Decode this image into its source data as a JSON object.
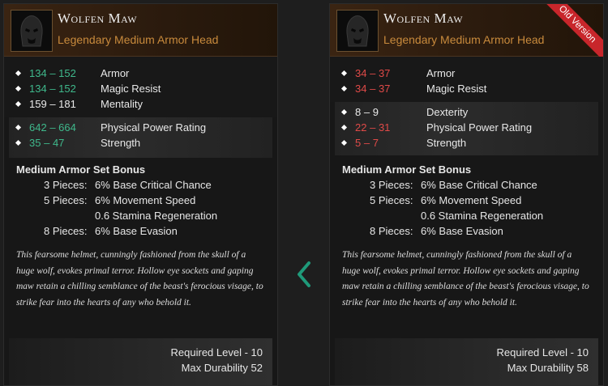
{
  "left_card": {
    "item_name": "Wolfen Maw",
    "item_type": "Legendary Medium Armor Head",
    "icon": "wolf-helmet-icon",
    "base_stats": [
      {
        "min": "134",
        "max": "152",
        "name": "Armor",
        "color": "green"
      },
      {
        "min": "134",
        "max": "152",
        "name": "Magic Resist",
        "color": "green"
      },
      {
        "min": "159",
        "max": "181",
        "name": "Mentality",
        "color": "white"
      }
    ],
    "bonus_stats": [
      {
        "min": "642",
        "max": "664",
        "name": "Physical Power Rating",
        "color": "green"
      },
      {
        "min": "35",
        "max": "47",
        "name": "Strength",
        "color": "green"
      }
    ],
    "set_bonus": {
      "title": "Medium Armor Set Bonus",
      "lines": [
        {
          "pieces": "3 Pieces:",
          "effect": "6% Base Critical Chance"
        },
        {
          "pieces": "5 Pieces:",
          "effect": "6% Movement Speed"
        },
        {
          "pieces": "",
          "effect": "0.6 Stamina Regeneration"
        },
        {
          "pieces": "8 Pieces:",
          "effect": "6% Base Evasion"
        }
      ]
    },
    "flavor": "This fearsome helmet, cunningly fashioned from the skull of a huge wolf, evokes primal terror. Hollow eye sockets and gaping maw retain a chilling semblance of the beast's ferocious visage, to strike fear into the hearts of any who behold it.",
    "required_level": "Required Level - 10",
    "max_durability": "Max Durability 52"
  },
  "right_card": {
    "item_name": "Wolfen Maw",
    "item_type": "Legendary Medium Armor Head",
    "icon": "wolf-helmet-icon",
    "ribbon": "Old Version",
    "base_stats": [
      {
        "min": "34",
        "max": "37",
        "name": "Armor",
        "color": "red"
      },
      {
        "min": "34",
        "max": "37",
        "name": "Magic Resist",
        "color": "red"
      }
    ],
    "bonus_stats": [
      {
        "min": "8",
        "max": "9",
        "name": "Dexterity",
        "color": "white"
      },
      {
        "min": "22",
        "max": "31",
        "name": "Physical Power Rating",
        "color": "red"
      },
      {
        "min": "5",
        "max": "7",
        "name": "Strength",
        "color": "red"
      }
    ],
    "set_bonus": {
      "title": "Medium Armor Set Bonus",
      "lines": [
        {
          "pieces": "3 Pieces:",
          "effect": "6% Base Critical Chance"
        },
        {
          "pieces": "5 Pieces:",
          "effect": "6% Movement Speed"
        },
        {
          "pieces": "",
          "effect": "0.6 Stamina Regeneration"
        },
        {
          "pieces": "8 Pieces:",
          "effect": "6% Base Evasion"
        }
      ]
    },
    "flavor": "This fearsome helmet, cunningly fashioned from the skull of a huge wolf, evokes primal terror. Hollow eye sockets and gaping maw retain a chilling semblance of the beast's ferocious visage, to strike fear into the hearts of any who behold it.",
    "required_level": "Required Level - 10",
    "max_durability": "Max Durability 58"
  },
  "compare_arrow": {
    "icon": "chevron-left-icon",
    "color": "#1f9a7a"
  },
  "colors": {
    "green": "#3fb98c",
    "red": "#e04a48",
    "legendary": "#c88a3c"
  }
}
